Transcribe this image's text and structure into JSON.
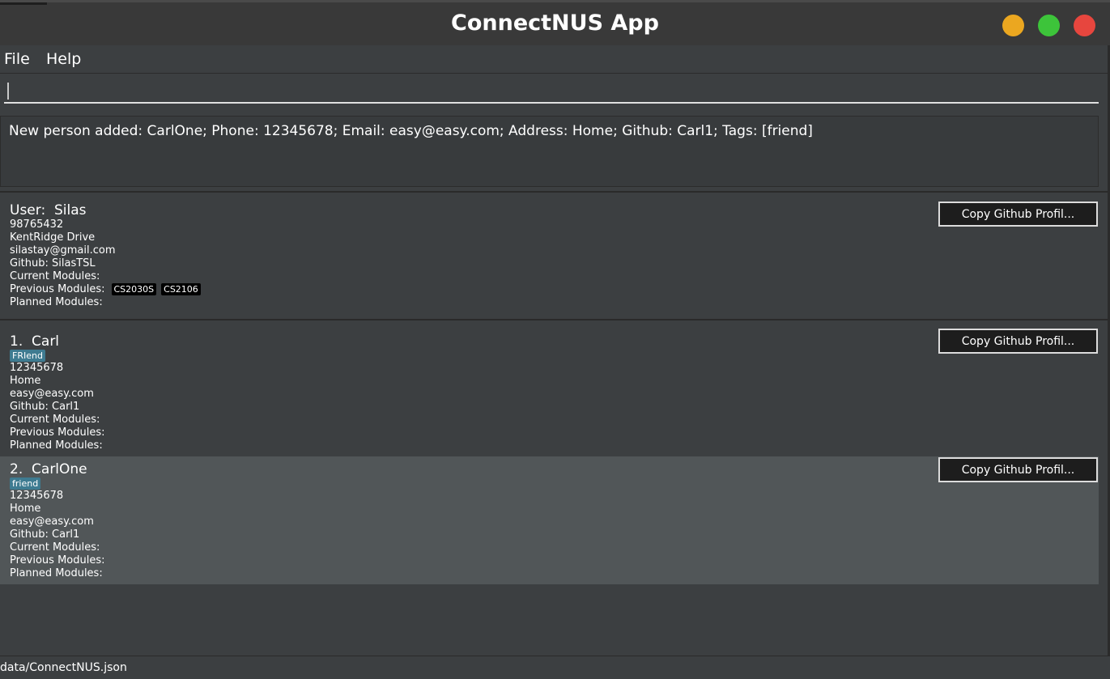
{
  "window": {
    "title": "ConnectNUS App"
  },
  "menu": {
    "file": "File",
    "help": "Help"
  },
  "command": {
    "value": ""
  },
  "result": {
    "message": "New person added: CarlOne; Phone: 12345678; Email: easy@easy.com; Address: Home; Github: Carl1; Tags: [friend]"
  },
  "user": {
    "name_line": "User:  Silas",
    "phone": "98765432",
    "address": "KentRidge Drive",
    "email": "silastay@gmail.com",
    "github": "Github: SilasTSL",
    "current_modules_label": "Current Modules:",
    "previous_modules_label": "Previous Modules:",
    "previous_modules": [
      "CS2030S",
      "CS2106"
    ],
    "planned_modules_label": "Planned Modules:",
    "copy_button": "Copy Github Profil..."
  },
  "persons": [
    {
      "name_line": "1.  Carl",
      "tag": "FRIend",
      "phone": "12345678",
      "address": "Home",
      "email": "easy@easy.com",
      "github": "Github: Carl1",
      "current_modules_label": "Current Modules:",
      "previous_modules_label": "Previous Modules:",
      "planned_modules_label": "Planned Modules:",
      "copy_button": "Copy Github Profil..."
    },
    {
      "name_line": "2.  CarlOne",
      "tag": "friend",
      "phone": "12345678",
      "address": "Home",
      "email": "easy@easy.com",
      "github": "Github: Carl1",
      "current_modules_label": "Current Modules:",
      "previous_modules_label": "Previous Modules:",
      "planned_modules_label": "Planned Modules:",
      "copy_button": "Copy Github Profil..."
    }
  ],
  "status": {
    "file_path": "data/ConnectNUS.json"
  },
  "colors": {
    "background": "#3c3f41",
    "selected_card": "#515658",
    "tag": "#3e7b91",
    "minimize": "#eba720",
    "maximize": "#3dc43a",
    "close": "#e7463e"
  },
  "icons": {
    "minimize": "minimize-window-icon",
    "maximize": "maximize-window-icon",
    "close": "close-window-icon"
  }
}
